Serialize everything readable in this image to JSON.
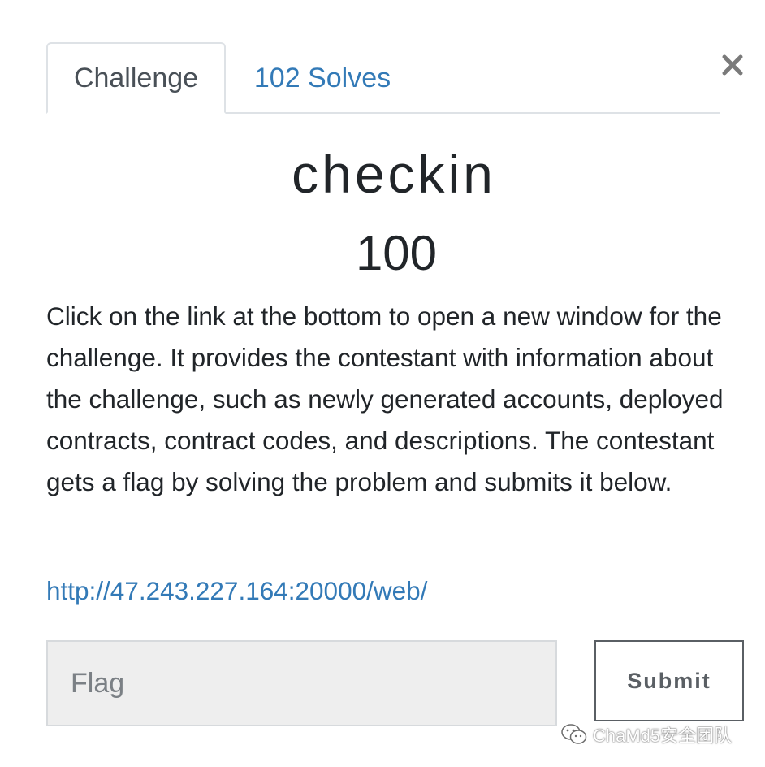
{
  "tabs": {
    "challenge": "Challenge",
    "solves": "102 Solves"
  },
  "close": {
    "icon": "close-icon",
    "glyph": "×"
  },
  "challenge": {
    "name": "checkin",
    "value": "100",
    "description": "Click on the link at the bottom to open a new window for the challenge. It provides the contestant with information about the challenge, such as newly generated accounts, deployed contracts, contract codes, and descriptions. The contestant gets a flag by solving the problem and submits it below.",
    "link": "http://47.243.227.164:20000/web/"
  },
  "form": {
    "flag_placeholder": "Flag",
    "flag_value": "",
    "submit_label": "Submit"
  },
  "watermark": {
    "icon": "wechat-icon",
    "text": "ChaMd5安全团队"
  },
  "colors": {
    "link": "#337ab7",
    "text": "#212529",
    "tab_border": "#dee2e6",
    "input_bg": "#eeeeee",
    "button_border": "#5a5f64"
  }
}
